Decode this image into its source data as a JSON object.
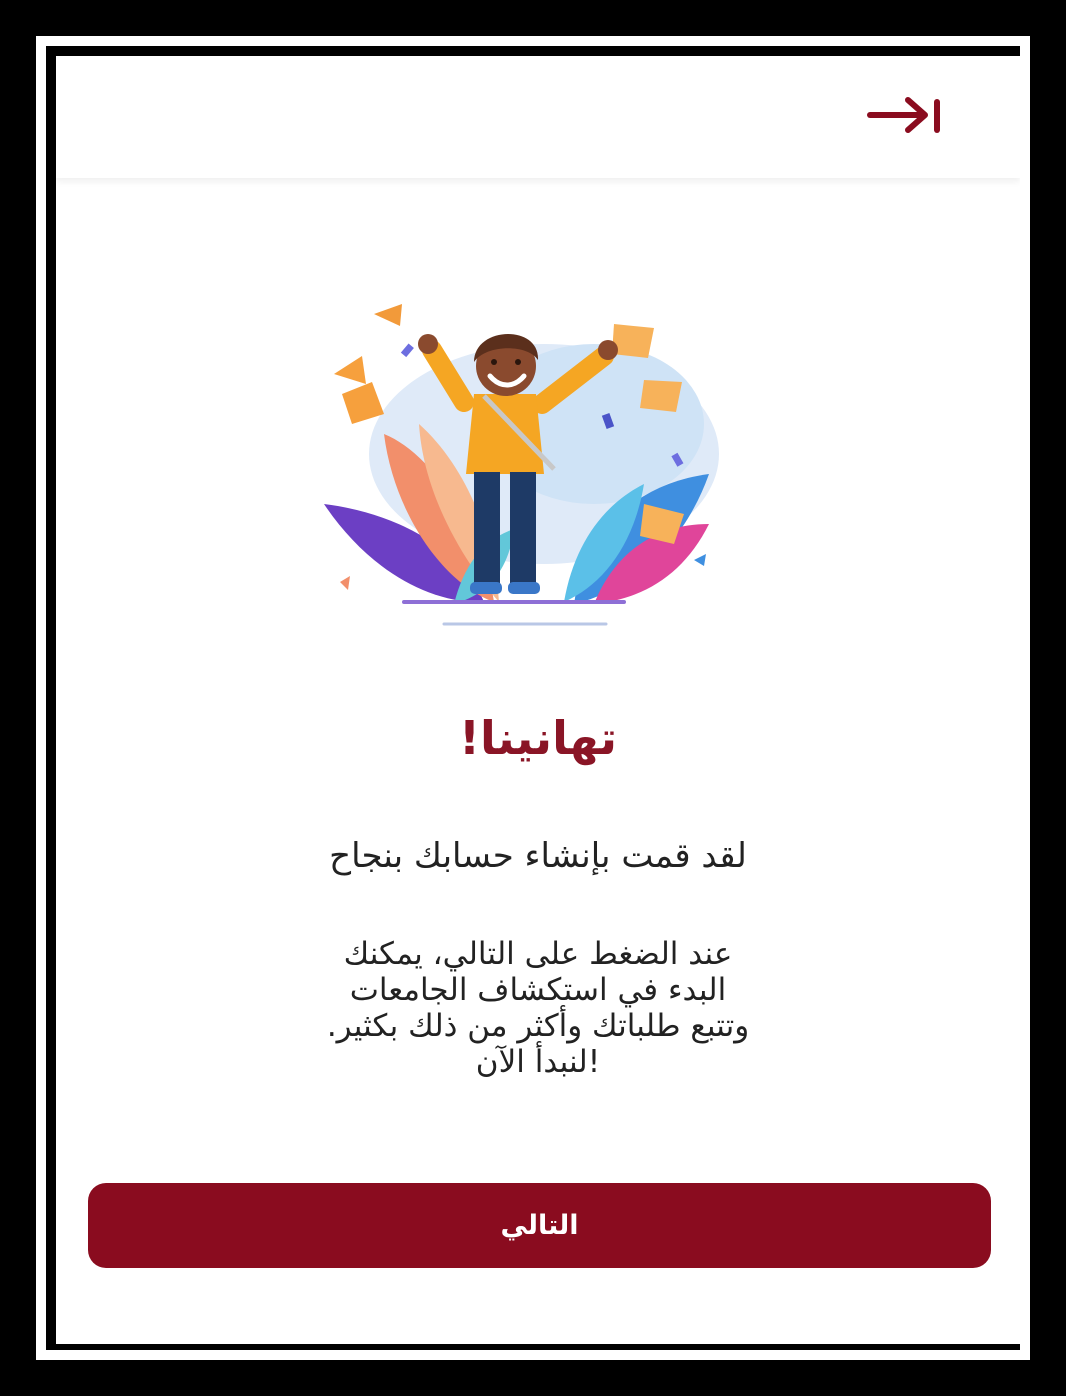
{
  "header": {
    "exit_icon": "exit-arrow-to-bar-icon"
  },
  "illustration": {
    "icon": "celebrating-person-illustration"
  },
  "main": {
    "title": "تهانينا!",
    "subtitle": "لقد قمت بإنشاء حسابك بنجاح",
    "body_lines": [
      "عند الضغط على التالي، يمكنك",
      "البدء في استكشاف الجامعات",
      "وتتبع طلباتك وأكثر من ذلك بكثير.",
      "!لنبدأ الآن"
    ]
  },
  "footer": {
    "next_label": "التالي"
  },
  "colors": {
    "brand": "#8a0c1f",
    "title": "#8a1526"
  }
}
